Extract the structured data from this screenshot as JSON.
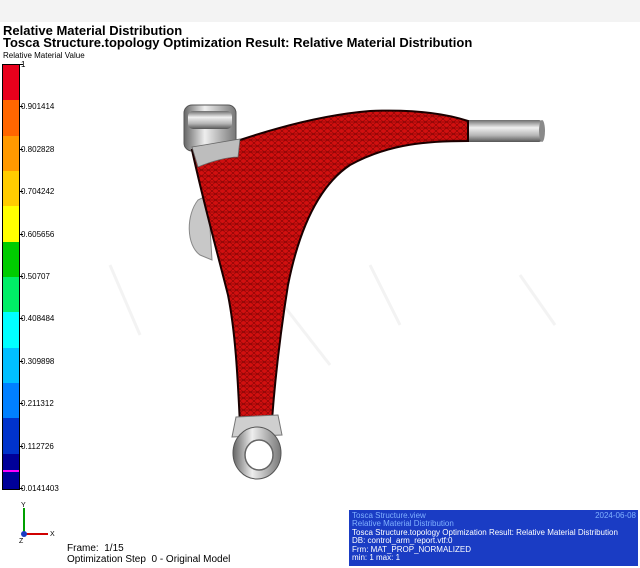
{
  "header": {
    "title": "Relative Material Distribution",
    "subtitle": "Tosca Structure.topology Optimization Result: Relative Material Distribution"
  },
  "legend": {
    "title": "Relative Material Value",
    "ticks": [
      "1",
      "0.901414",
      "0.802828",
      "0.704242",
      "0.605656",
      "0.50707",
      "0.408484",
      "0.309898",
      "0.211312",
      "0.112726",
      "0.0141403"
    ],
    "band_colors": [
      "#e8001c",
      "#ff6600",
      "#ff9900",
      "#ffcc00",
      "#ffff00",
      "#00cc00",
      "#00ee66",
      "#00ffff",
      "#00bfff",
      "#0080ff",
      "#0033cc",
      "#000099"
    ]
  },
  "frame": {
    "frame_line": "Frame:  1/15",
    "step_line": "Optimization Step  0 - Original Model"
  },
  "triad": {
    "y_label": "Y",
    "x_label": "X",
    "z_label": "Z"
  },
  "info": {
    "line1": "Tosca Structure.view",
    "date": "2024-06-08",
    "line2": "Relative Material Distribution",
    "line3": "Tosca Structure.topology Optimization Result: Relative Material Distribution",
    "line4": "DB:  control_arm_report.vtf:0",
    "line5": "Frm:  MAT_PROP_NORMALIZED",
    "line6": "       min: 1  max: 1"
  },
  "colors": {
    "material": "#d10f0f",
    "mesh": "#5a0000",
    "metal": "#a0a0a0",
    "info_bg": "#1a3cc4"
  }
}
